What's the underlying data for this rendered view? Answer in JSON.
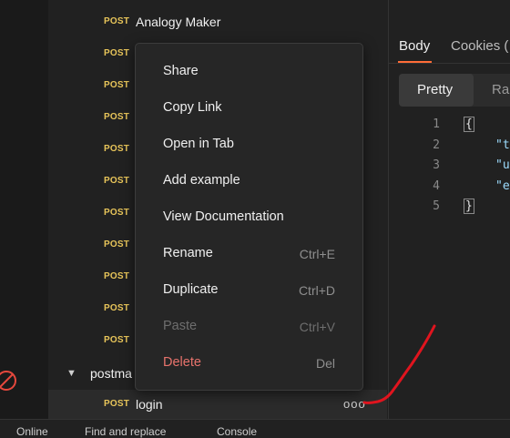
{
  "sidebar": {
    "requests": [
      {
        "method": "POST",
        "name": "Analogy Maker"
      },
      {
        "method": "POST",
        "name": ""
      },
      {
        "method": "POST",
        "name": ""
      },
      {
        "method": "POST",
        "name": ""
      },
      {
        "method": "POST",
        "name": ""
      },
      {
        "method": "POST",
        "name": ""
      },
      {
        "method": "POST",
        "name": ""
      },
      {
        "method": "POST",
        "name": ""
      },
      {
        "method": "POST",
        "name": ""
      },
      {
        "method": "POST",
        "name": ""
      },
      {
        "method": "POST",
        "name": ""
      }
    ],
    "folder": {
      "name": "postma"
    },
    "selected": {
      "method": "POST",
      "name": "login",
      "more": "ooo"
    }
  },
  "context_menu": {
    "items": [
      {
        "label": "Share",
        "shortcut": ""
      },
      {
        "label": "Copy Link",
        "shortcut": ""
      },
      {
        "label": "Open in Tab",
        "shortcut": ""
      },
      {
        "label": "Add example",
        "shortcut": ""
      },
      {
        "label": "View Documentation",
        "shortcut": ""
      },
      {
        "label": "Rename",
        "shortcut": "Ctrl+E"
      },
      {
        "label": "Duplicate",
        "shortcut": "Ctrl+D"
      },
      {
        "label": "Paste",
        "shortcut": "Ctrl+V"
      },
      {
        "label": "Delete",
        "shortcut": "Del"
      }
    ]
  },
  "response": {
    "tabs": {
      "body": "Body",
      "cookies": "Cookies ("
    },
    "view": {
      "pretty": "Pretty",
      "raw": "Ra"
    },
    "lines": [
      {
        "num": "1",
        "text": "{"
      },
      {
        "num": "2",
        "text": "\"t"
      },
      {
        "num": "3",
        "text": "\"u"
      },
      {
        "num": "4",
        "text": "\"e"
      },
      {
        "num": "5",
        "text": "}"
      }
    ]
  },
  "bottom_bar": {
    "online": "Online",
    "find": "Find and replace",
    "console": "Console"
  },
  "colors": {
    "method_post": "#e8c55a",
    "accent": "#ff6c37",
    "delete": "#e8736c",
    "annotation": "#e0141e"
  },
  "icons": {
    "folder_toggle": "chevron-down-icon",
    "blocked": "no-sign-icon",
    "more": "more-horizontal-icon"
  }
}
